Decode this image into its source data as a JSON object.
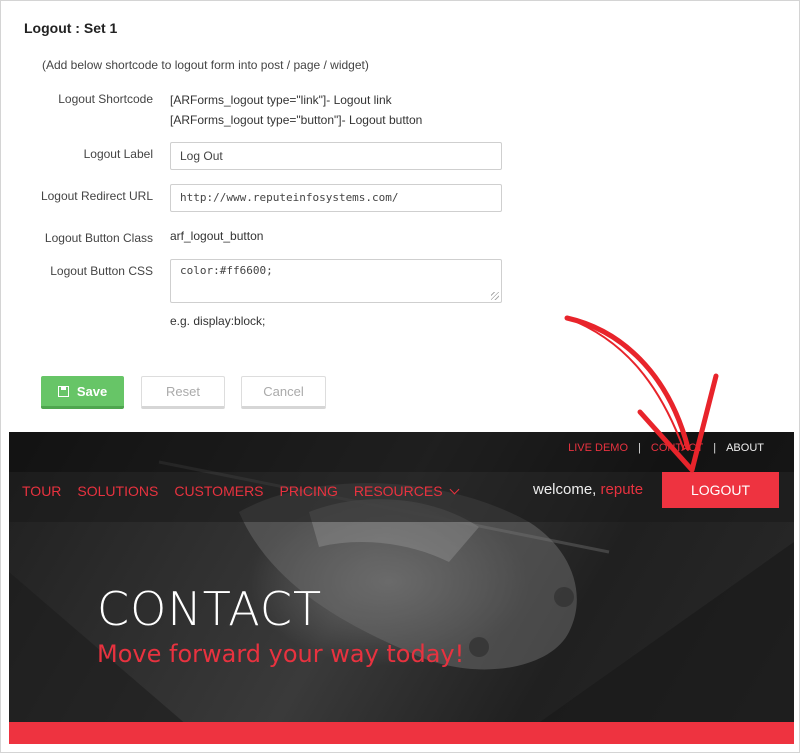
{
  "form": {
    "title": "Logout : Set 1",
    "note": "(Add below shortcode to logout form into post / page / widget)",
    "shortcode_label": "Logout Shortcode",
    "shortcode_link": "[ARForms_logout type=\"link\"]- Logout link",
    "shortcode_button": "[ARForms_logout type=\"button\"]- Logout button",
    "label_label": "Logout Label",
    "label_value": "Log Out",
    "redirect_label": "Logout Redirect URL",
    "redirect_value": "http://www.reputeinfosystems.com/",
    "class_label": "Logout Button Class",
    "class_value": "arf_logout_button",
    "css_label": "Logout Button CSS",
    "css_value": "color:#ff6600;",
    "css_hint": "e.g. display:block;",
    "save_label": "Save",
    "reset_label": "Reset",
    "cancel_label": "Cancel"
  },
  "site": {
    "top_links": [
      "LIVE DEMO",
      "CONTACT",
      "ABOUT"
    ],
    "nav": [
      "TOUR",
      "SOLUTIONS",
      "CUSTOMERS",
      "PRICING",
      "RESOURCES"
    ],
    "welcome": "welcome,",
    "username": "repute",
    "logout_button": "LOGOUT",
    "hero_title": "CONTACT",
    "hero_subtitle": "Move forward your way today!"
  },
  "colors": {
    "accent": "#ee3340",
    "save_green": "#67c567"
  }
}
